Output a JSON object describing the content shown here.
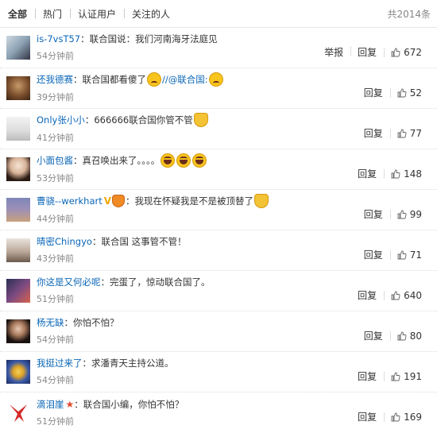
{
  "tabs": [
    "全部",
    "热门",
    "认证用户",
    "关注的人"
  ],
  "total": "共2014条",
  "comments": [
    {
      "user": "is-7vsT57",
      "sep": "：",
      "text": "联合国说：我们河南海牙法庭见",
      "time": "54分钟前",
      "report": "举报",
      "reply": "回复",
      "likes": "672",
      "avatar": "avatar-1"
    },
    {
      "user": "还我德赛",
      "sep": "：",
      "text": "联合国都看傻了",
      "text2": "//@联合国:",
      "time": "39分钟前",
      "reply": "回复",
      "likes": "52",
      "avatar": "avatar-2"
    },
    {
      "user": "Only张小小",
      "sep": "：",
      "text": "666666联合国你管不管",
      "time": "41分钟前",
      "reply": "回复",
      "likes": "77",
      "avatar": "avatar-3"
    },
    {
      "user": "小面包酱",
      "sep": "：",
      "text": "真召唤出来了。。。。",
      "time": "53分钟前",
      "reply": "回复",
      "likes": "148",
      "avatar": "avatar-4"
    },
    {
      "user": "曹骁--werkhart",
      "sep": "：",
      "text": "我现在怀疑我是不是被顶替了",
      "time": "44分钟前",
      "reply": "回复",
      "likes": "99",
      "avatar": "avatar-5"
    },
    {
      "user": "晴密Chingyo",
      "sep": "：",
      "text": "联合国 这事管不管！",
      "time": "43分钟前",
      "reply": "回复",
      "likes": "71",
      "avatar": "avatar-6"
    },
    {
      "user": "你这是又何必呢",
      "sep": "：",
      "text": "完蛋了，惊动联合国了。",
      "time": "51分钟前",
      "reply": "回复",
      "likes": "640",
      "avatar": "avatar-7"
    },
    {
      "user": "杨无缺",
      "sep": "：",
      "text": "你怕不怕？",
      "time": "54分钟前",
      "reply": "回复",
      "likes": "80",
      "avatar": "avatar-8"
    },
    {
      "user": "我挺过来了",
      "sep": "：",
      "text": "求潘青天主持公道。",
      "time": "54分钟前",
      "reply": "回复",
      "likes": "191",
      "avatar": "avatar-9"
    },
    {
      "user": "滴泪崖",
      "sep": "：",
      "text": "联合国小编，你怕不怕？",
      "time": "51分钟前",
      "reply": "回复",
      "likes": "169",
      "avatar": "avatar-10"
    }
  ],
  "colors": {
    "link": "#0a66b7",
    "muted": "#888888",
    "text": "#333333"
  }
}
